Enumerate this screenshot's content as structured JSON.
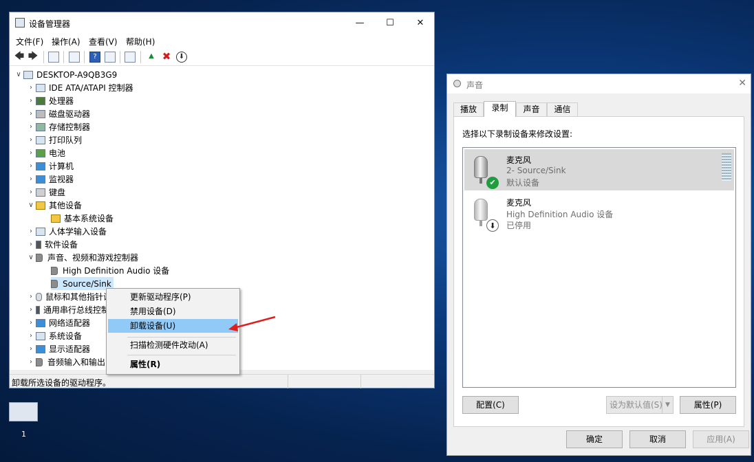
{
  "device_manager": {
    "title": "设备管理器",
    "menu": [
      "文件(F)",
      "操作(A)",
      "查看(V)",
      "帮助(H)"
    ],
    "tree": {
      "root": "DESKTOP-A9QB3G9",
      "items": [
        "IDE ATA/ATAPI 控制器",
        "处理器",
        "磁盘驱动器",
        "存储控制器",
        "打印队列",
        "电池",
        "计算机",
        "监视器",
        "键盘",
        "其他设备",
        "基本系统设备",
        "人体学输入设备",
        "软件设备",
        "声音、视频和游戏控制器",
        "High Definition Audio 设备",
        "Source/Sink",
        "鼠标和其他指针设备",
        "通用串行总线控制器",
        "网络适配器",
        "系统设备",
        "显示适配器",
        "音频输入和输出"
      ]
    },
    "status": "卸载所选设备的驱动程序。"
  },
  "context_menu": {
    "items": [
      "更新驱动程序(P)",
      "禁用设备(D)",
      "卸载设备(U)",
      "扫描检测硬件改动(A)",
      "属性(R)"
    ]
  },
  "sound_dialog": {
    "title": "声音",
    "tabs": [
      "播放",
      "录制",
      "声音",
      "通信"
    ],
    "instruction": "选择以下录制设备来修改设置:",
    "devices": [
      {
        "name": "麦克风",
        "desc": "2- Source/Sink",
        "state": "默认设备"
      },
      {
        "name": "麦克风",
        "desc": "High Definition Audio 设备",
        "state": "已停用"
      }
    ],
    "buttons": {
      "configure": "配置(C)",
      "set_default": "设为默认值(S)",
      "properties": "属性(P)",
      "ok": "确定",
      "cancel": "取消",
      "apply": "应用(A)"
    }
  },
  "desktop": {
    "taskbar_label": "1"
  },
  "colors": {
    "selected": "#cce8ff",
    "menu_highlight": "#91c9f7",
    "arrow": "#e01e1e"
  }
}
